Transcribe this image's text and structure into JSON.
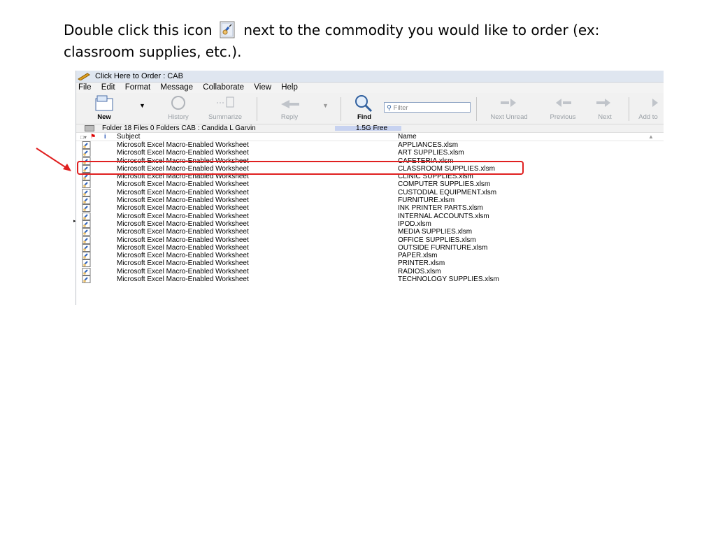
{
  "instruction": {
    "text_before": "Double click this icon",
    "text_after": "next to the commodity you would like to order (ex: classroom supplies, etc.)."
  },
  "window": {
    "title": "Click Here to Order : CAB"
  },
  "menu": [
    "File",
    "Edit",
    "Format",
    "Message",
    "Collaborate",
    "View",
    "Help"
  ],
  "toolbar": {
    "new": "New",
    "history": "History",
    "summarize": "Summarize",
    "reply": "Reply",
    "find": "Find",
    "filter_placeholder": "Filter",
    "next_unread": "Next Unread",
    "previous": "Previous",
    "next": "Next",
    "add_to": "Add to"
  },
  "status": {
    "folder": "Folder   18 Files  0 Folders   CAB : Candida L Garvin",
    "free": "1.5G Free"
  },
  "columns": {
    "subject": "Subject",
    "name": "Name"
  },
  "rows": [
    {
      "subject": "Microsoft Excel Macro-Enabled Worksheet",
      "name": "APPLIANCES.xlsm"
    },
    {
      "subject": "Microsoft Excel Macro-Enabled Worksheet",
      "name": "ART SUPPLIES.xlsm"
    },
    {
      "subject": "Microsoft Excel Macro-Enabled Worksheet",
      "name": "CAFETERIA.xlsm"
    },
    {
      "subject": "Microsoft Excel Macro-Enabled Worksheet",
      "name": "CLASSROOM SUPPLIES.xlsm"
    },
    {
      "subject": "Microsoft Excel Macro-Enabled Worksheet",
      "name": "CLINIC SUPPLIES.xlsm"
    },
    {
      "subject": "Microsoft Excel Macro-Enabled Worksheet",
      "name": "COMPUTER SUPPLIES.xlsm"
    },
    {
      "subject": "Microsoft Excel Macro-Enabled Worksheet",
      "name": "CUSTODIAL EQUIPMENT.xlsm"
    },
    {
      "subject": "Microsoft Excel Macro-Enabled Worksheet",
      "name": "FURNITURE.xlsm"
    },
    {
      "subject": "Microsoft Excel Macro-Enabled Worksheet",
      "name": "INK PRINTER PARTS.xlsm"
    },
    {
      "subject": "Microsoft Excel Macro-Enabled Worksheet",
      "name": "INTERNAL ACCOUNTS.xlsm"
    },
    {
      "subject": "Microsoft Excel Macro-Enabled Worksheet",
      "name": "IPOD.xlsm"
    },
    {
      "subject": "Microsoft Excel Macro-Enabled Worksheet",
      "name": "MEDIA SUPPLIES.xlsm"
    },
    {
      "subject": "Microsoft Excel Macro-Enabled Worksheet",
      "name": "OFFICE SUPPLIES.xlsm"
    },
    {
      "subject": "Microsoft Excel Macro-Enabled Worksheet",
      "name": "OUTSIDE FURNITURE.xlsm"
    },
    {
      "subject": "Microsoft Excel Macro-Enabled Worksheet",
      "name": "PAPER.xlsm"
    },
    {
      "subject": "Microsoft Excel Macro-Enabled Worksheet",
      "name": "PRINTER.xlsm"
    },
    {
      "subject": "Microsoft Excel Macro-Enabled Worksheet",
      "name": "RADIOS.xlsm"
    },
    {
      "subject": "Microsoft Excel Macro-Enabled Worksheet",
      "name": "TECHNOLOGY SUPPLIES.xlsm"
    }
  ],
  "colors": {
    "highlight": "#e02020",
    "arrow": "#e02020"
  },
  "icons": {
    "title": "notes-pencil-icon",
    "row": "excel-attachment-icon"
  }
}
